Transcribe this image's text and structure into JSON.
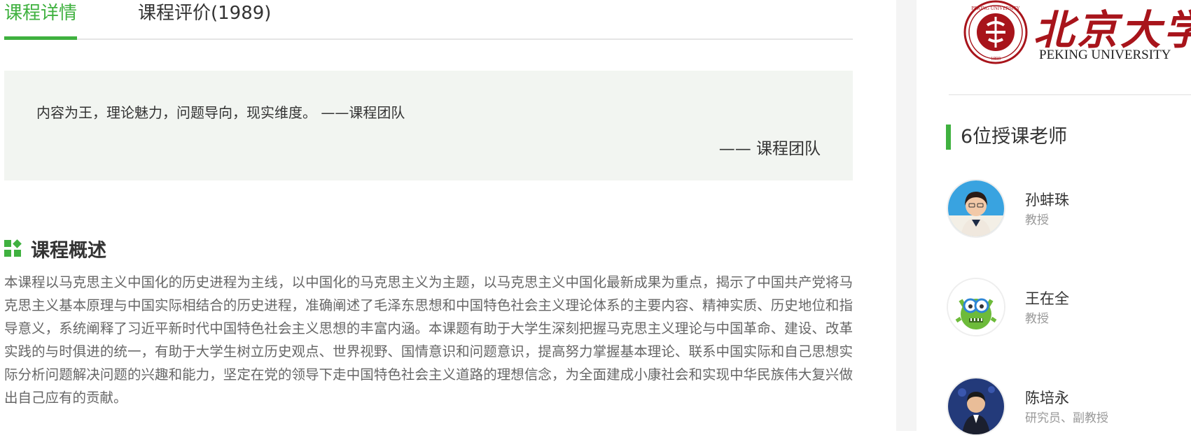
{
  "tabs": [
    {
      "label": "课程详情",
      "active": true
    },
    {
      "label": "课程评价(1989)",
      "active": false
    }
  ],
  "quote": {
    "text": "内容为王，理论魅力，问题导向，现实维度。 ——课程团队",
    "source": "—— 课程团队"
  },
  "overview": {
    "title": "课程概述",
    "icon": "grid-icon",
    "description": "本课程以马克思主义中国化的历史进程为主线，以中国化的马克思主义为主题，以马克思主义中国化最新成果为重点，揭示了中国共产党将马克思主义基本原理与中国实际相结合的历史进程，准确阐述了毛泽东思想和中国特色社会主义理论体系的主要内容、精神实质、历史地位和指导意义，系统阐释了习近平新时代中国特色社会主义思想的丰富内涵。本课题有助于大学生深刻把握马克思主义理论与中国革命、建设、改革实践的与时俱进的统一，有助于大学生树立历史观点、世界视野、国情意识和问题意识，提高努力掌握基本理论、联系中国实际和自己思想实际分析问题解决问题的兴趣和能力，坚定在党的领导下走中国特色社会主义道路的理想信念，为全面建成小康社会和实现中华民族伟大复兴做出自己应有的贡献。"
  },
  "school": {
    "name_cn": "北京大学",
    "name_en": "PEKING UNIVERSITY",
    "seal_text": "PEKING UNIVERSITY",
    "seal_year": "1898"
  },
  "teachers": {
    "heading": "6位授课老师",
    "items": [
      {
        "name": "孙蚌珠",
        "title": "教授",
        "avatar": "portrait-woman"
      },
      {
        "name": "王在全",
        "title": "教授",
        "avatar": "green-monster-avatar"
      },
      {
        "name": "陈培永",
        "title": "研究员、副教授",
        "avatar": "portrait-man-speaking"
      }
    ]
  },
  "colors": {
    "accent": "#3fb13f",
    "brand_red": "#a8141b",
    "quote_bg": "#f2f5f1"
  }
}
